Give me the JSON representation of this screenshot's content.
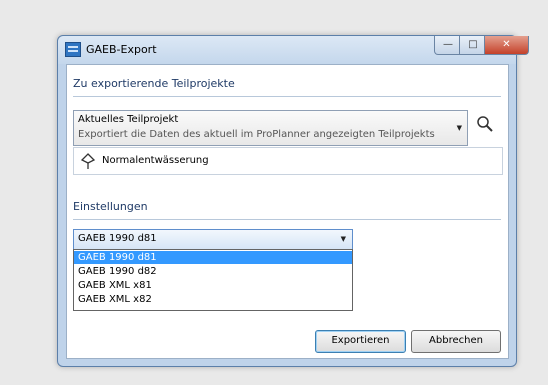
{
  "window": {
    "title": "GAEB-Export",
    "min_glyph": "—",
    "max_glyph": "□",
    "close_glyph": "✕"
  },
  "projects_section": {
    "heading": "Zu exportierende Teilprojekte",
    "combo": {
      "title": "Aktuelles Teilprojekt",
      "description": "Exportiert die Daten des aktuell im ProPlanner angezeigten Teilprojekts"
    },
    "project_name": "Normalentwässerung",
    "icons": {
      "search": "search-icon",
      "project": "pin-icon"
    }
  },
  "settings_section": {
    "heading": "Einstellungen",
    "selected": "GAEB 1990 d81",
    "options": [
      "GAEB 1990 d81",
      "GAEB 1990 d82",
      "GAEB XML x81",
      "GAEB XML x82"
    ]
  },
  "buttons": {
    "export": "Exportieren",
    "cancel": "Abbrechen"
  },
  "colors": {
    "selection": "#3399ff",
    "close_button": "#c4412a",
    "section_heading": "#1f3a66"
  }
}
